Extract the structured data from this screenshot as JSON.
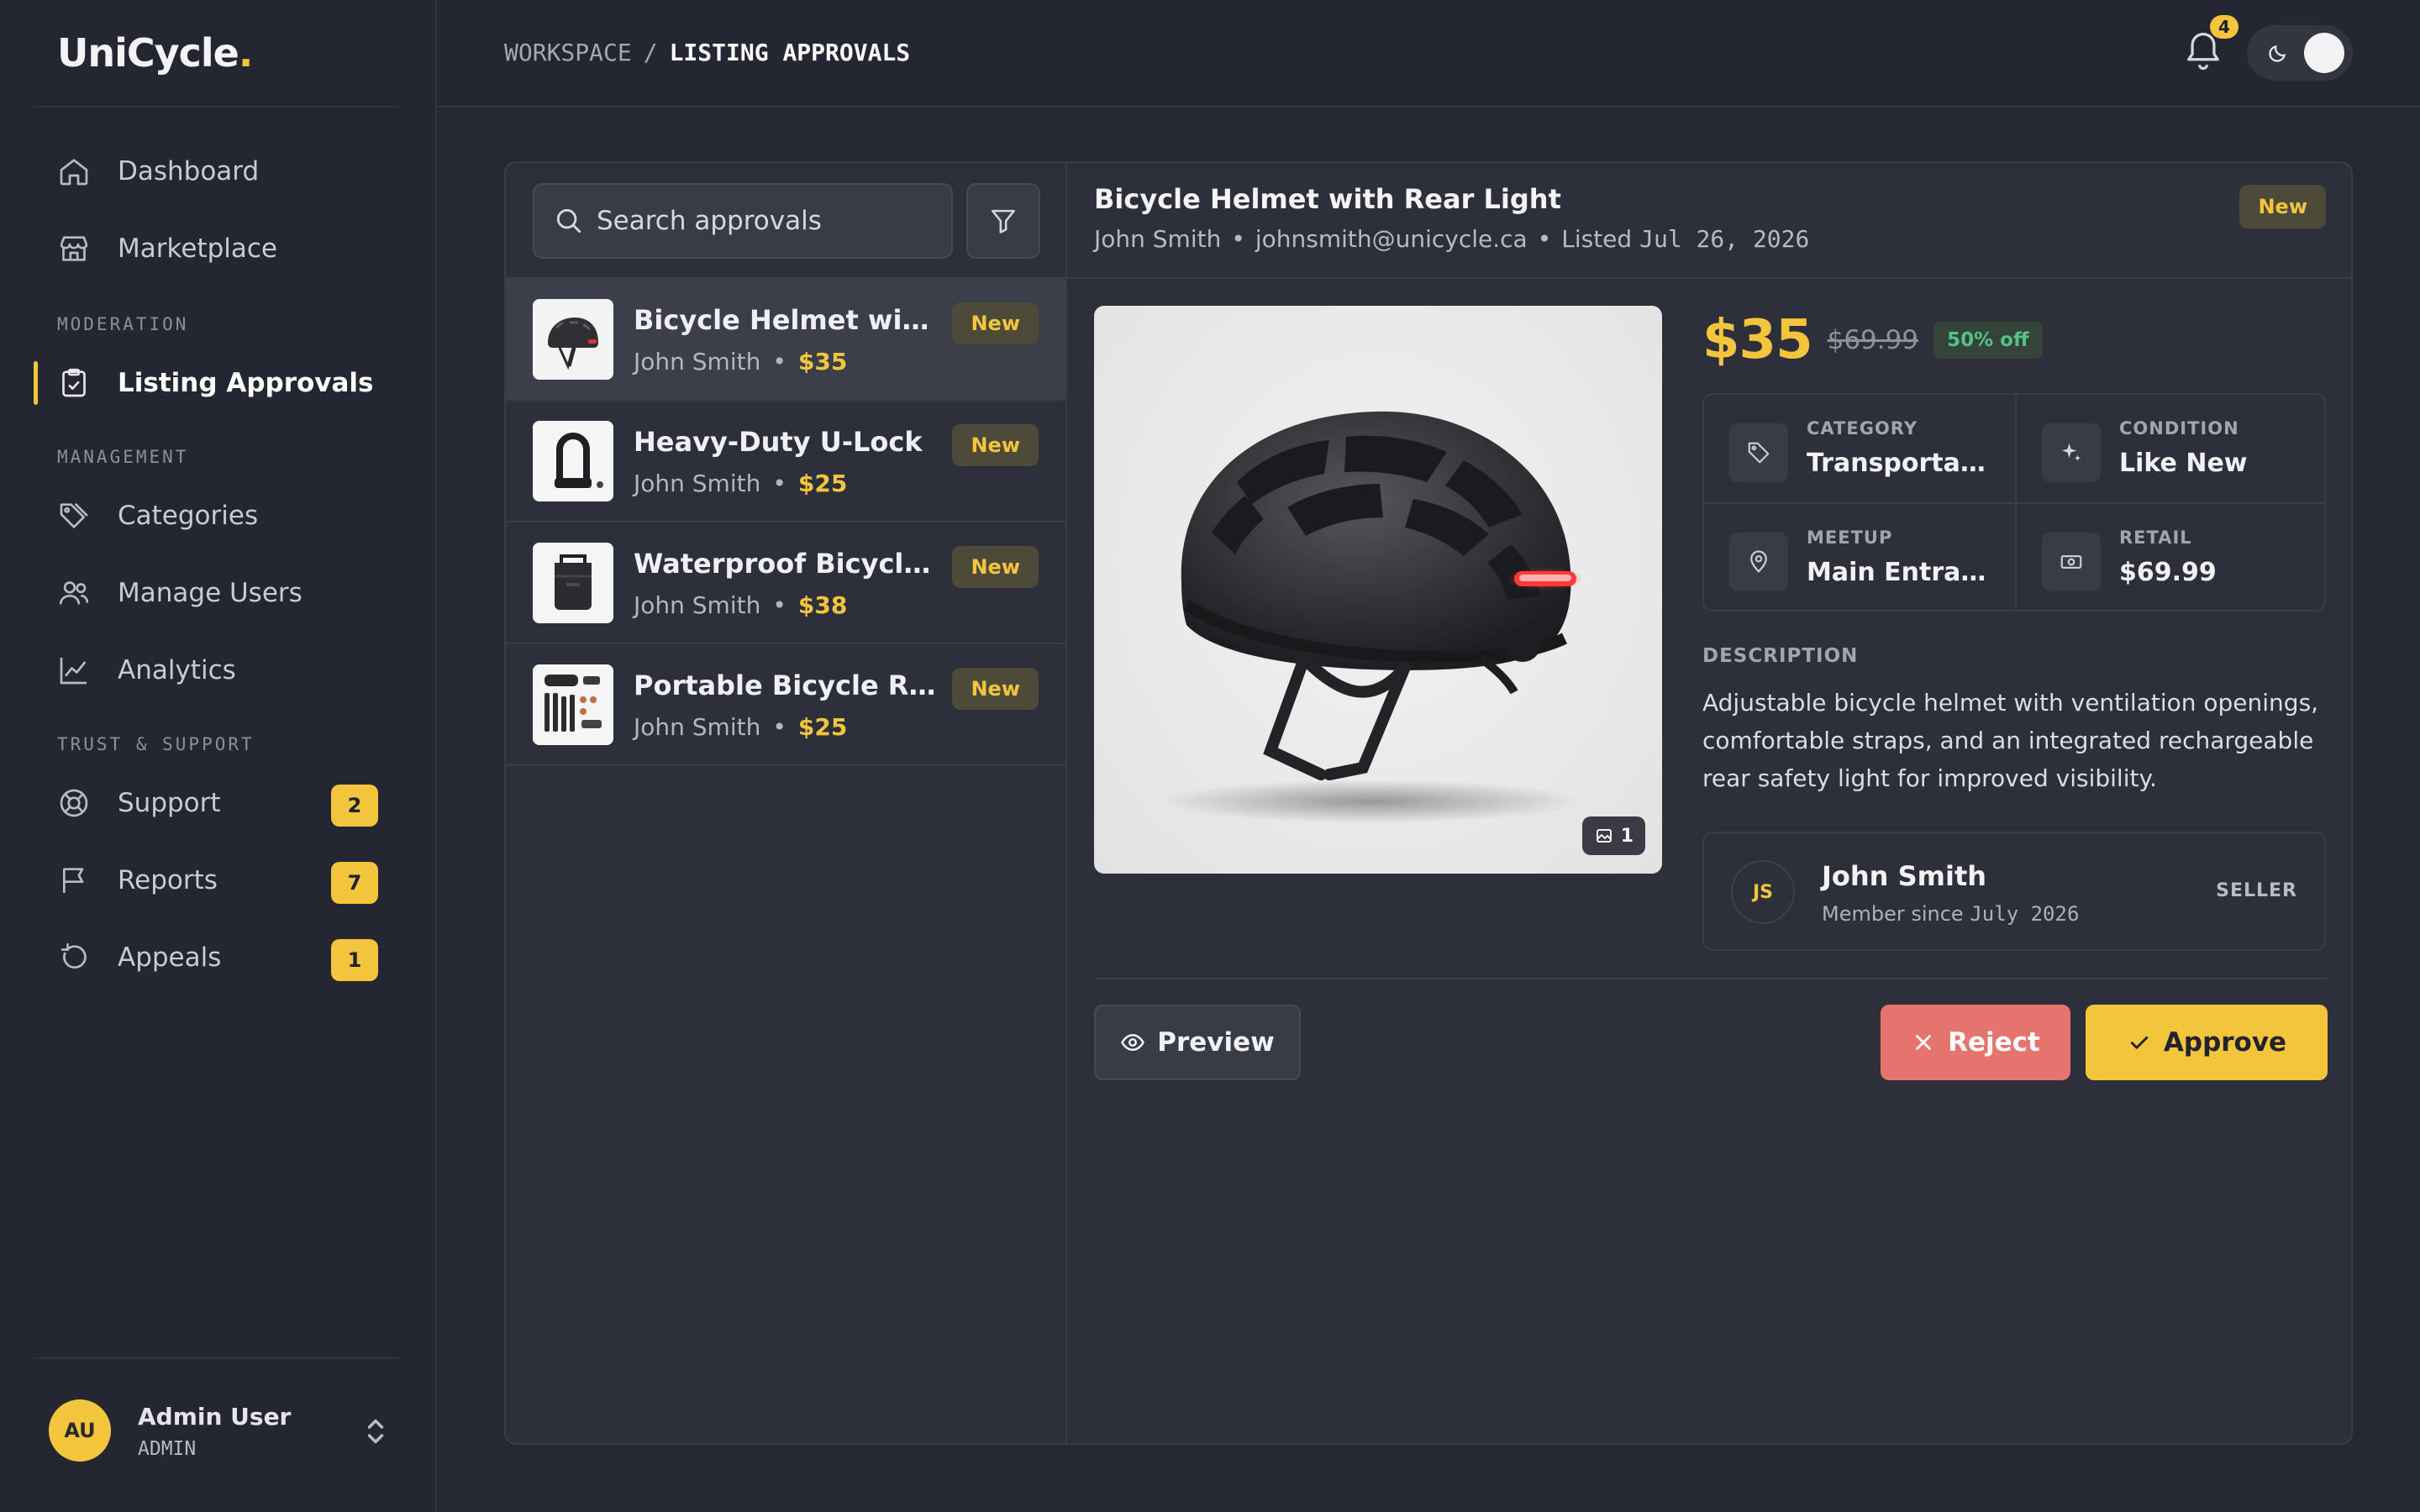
{
  "app": {
    "logo_text": "UniCycle",
    "logo_dot": "."
  },
  "sidebar": {
    "nav": [
      {
        "label": "Dashboard",
        "icon": "home-icon"
      },
      {
        "label": "Marketplace",
        "icon": "store-icon"
      }
    ],
    "sections": [
      {
        "label": "MODERATION",
        "items": [
          {
            "label": "Listing Approvals",
            "icon": "clipboard-check-icon",
            "active": true
          }
        ]
      },
      {
        "label": "MANAGEMENT",
        "items": [
          {
            "label": "Categories",
            "icon": "tags-icon"
          },
          {
            "label": "Manage Users",
            "icon": "users-icon"
          },
          {
            "label": "Analytics",
            "icon": "chart-line-icon"
          }
        ]
      },
      {
        "label": "TRUST & SUPPORT",
        "items": [
          {
            "label": "Support",
            "icon": "lifebuoy-icon",
            "badge": "2"
          },
          {
            "label": "Reports",
            "icon": "flag-icon",
            "badge": "7"
          },
          {
            "label": "Appeals",
            "icon": "rotate-icon",
            "badge": "1"
          }
        ]
      }
    ],
    "user": {
      "initials": "AU",
      "name": "Admin User",
      "role": "ADMIN"
    }
  },
  "topbar": {
    "breadcrumb_root": "WORKSPACE",
    "breadcrumb_sep": "/",
    "breadcrumb_current": "LISTING APPROVALS",
    "notification_count": "4",
    "theme": "dark"
  },
  "list": {
    "search_placeholder": "Search approvals",
    "items": [
      {
        "title": "Bicycle Helmet with Rear Light",
        "seller": "John Smith",
        "price": "$35",
        "badge": "New",
        "selected": true
      },
      {
        "title": "Heavy-Duty U-Lock",
        "seller": "John Smith",
        "price": "$25",
        "badge": "New"
      },
      {
        "title": "Waterproof Bicycle Pannier Bag",
        "seller": "John Smith",
        "price": "$38",
        "badge": "New"
      },
      {
        "title": "Portable Bicycle Repair Kit",
        "seller": "John Smith",
        "price": "$25",
        "badge": "New"
      }
    ],
    "separator": "•"
  },
  "detail": {
    "title": "Bicycle Helmet with Rear Light",
    "seller_name": "John Smith",
    "seller_email": "johnsmith@unicycle.ca",
    "listed_label": "Listed",
    "listed_date": "Jul 26, 2026",
    "badge": "New",
    "image_count": "1",
    "price": "$35",
    "original_price": "$69.99",
    "discount": "50% off",
    "specs": {
      "category_label": "CATEGORY",
      "category": "Transportation",
      "condition_label": "CONDITION",
      "condition": "Like New",
      "meetup_label": "MEETUP",
      "meetup": "Main Entrance",
      "retail_label": "RETAIL",
      "retail": "$69.99"
    },
    "description_label": "DESCRIPTION",
    "description": "Adjustable bicycle helmet with ventilation openings, comfortable straps, and an integrated rechargeable rear safety light for improved visibility.",
    "seller_card": {
      "initials": "JS",
      "name": "John Smith",
      "since_label": "Member since",
      "since_date": "July 2026",
      "role": "SELLER"
    },
    "actions": {
      "preview": "Preview",
      "reject": "Reject",
      "approve": "Approve"
    }
  },
  "colors": {
    "accent": "#f2c53d",
    "reject": "#e5736e",
    "discount": "#52c48a",
    "background": "#252731"
  }
}
